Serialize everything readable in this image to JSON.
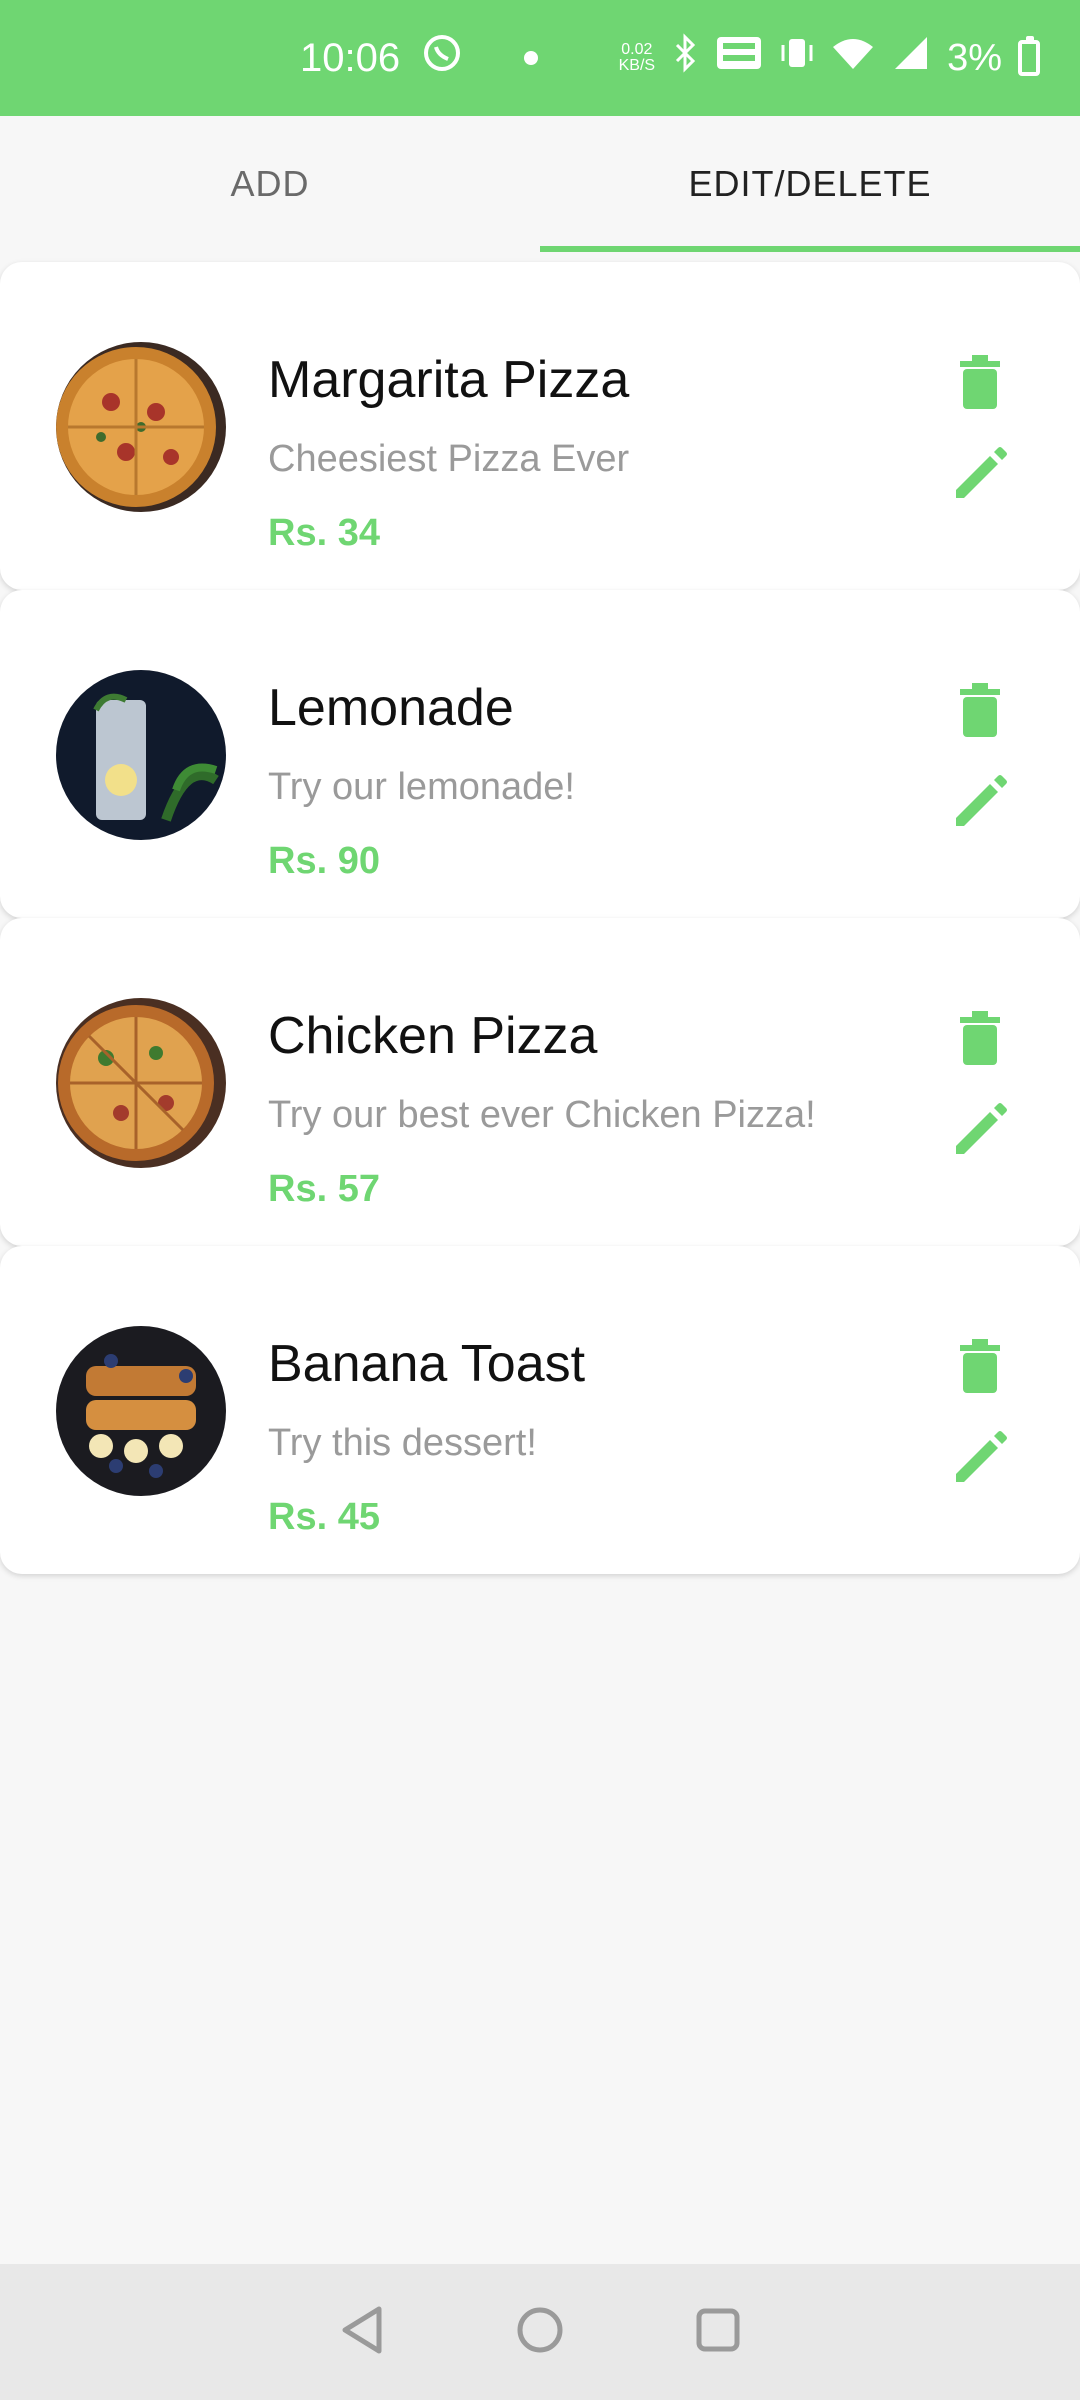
{
  "status_bar": {
    "time": "10:06",
    "speed_value": "0.02",
    "speed_unit": "KB/S",
    "battery": "3%"
  },
  "tabs": [
    {
      "label": "ADD"
    },
    {
      "label": "EDIT/DELETE"
    }
  ],
  "items": [
    {
      "title": "Margarita Pizza",
      "description": "Cheesiest Pizza Ever",
      "price": "Rs. 34",
      "image": "margarita-pizza-photo"
    },
    {
      "title": "Lemonade",
      "description": "Try our lemonade!",
      "price": "Rs. 90",
      "image": "lemonade-photo"
    },
    {
      "title": "Chicken Pizza",
      "description": "Try our best ever Chicken Pizza!",
      "price": "Rs. 57",
      "image": "chicken-pizza-photo"
    },
    {
      "title": "Banana Toast",
      "description": "Try this dessert!",
      "price": "Rs. 45",
      "image": "banana-toast-photo"
    }
  ],
  "colors": {
    "accent": "#6fd672",
    "icon_color": "#6fd672"
  },
  "icons": {
    "delete": "trash-icon",
    "edit": "pencil-icon"
  }
}
